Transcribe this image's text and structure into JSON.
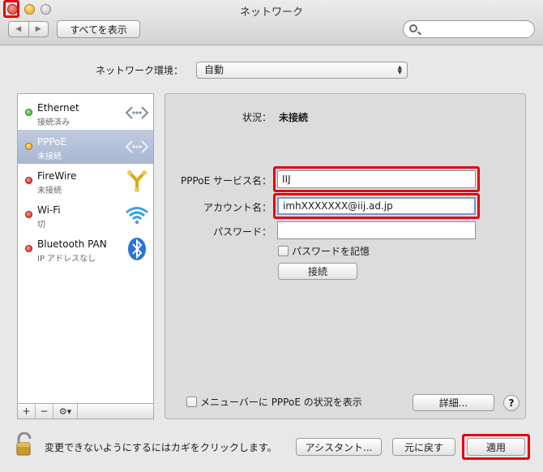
{
  "window": {
    "title": "ネットワーク"
  },
  "toolbar": {
    "show_all_label": "すべてを表示",
    "search_placeholder": ""
  },
  "location": {
    "label": "ネットワーク環境：",
    "value": "自動"
  },
  "services": [
    {
      "name": "Ethernet",
      "status": "接続済み",
      "icon": "ethernet-arrows-icon",
      "dot": "green"
    },
    {
      "name": "PPPoE",
      "status": "未接続",
      "icon": "ethernet-arrows-icon",
      "dot": "yellow",
      "selected": true
    },
    {
      "name": "FireWire",
      "status": "未接続",
      "icon": "firewire-icon",
      "dot": "red"
    },
    {
      "name": "Wi-Fi",
      "status": "切",
      "icon": "wifi-icon",
      "dot": "red"
    },
    {
      "name": "Bluetooth PAN",
      "status": "IP アドレスなし",
      "icon": "bluetooth-icon",
      "dot": "red"
    }
  ],
  "sidebar_actions": {
    "add": "+",
    "remove": "−",
    "gear": "⚙▾"
  },
  "panel": {
    "status_label": "状況：",
    "status_value": "未接続",
    "service_name_label": "PPPoE サービス名：",
    "service_name_value": "IIJ",
    "account_label": "アカウント名：",
    "account_value": "imhXXXXXXX@iij.ad.jp",
    "password_label": "パスワード：",
    "password_value": "",
    "remember_password_label": "パスワードを記憶",
    "connect_label": "接続",
    "menubar_status_label": "メニューバーに PPPoE の状況を表示",
    "advanced_label": "詳細...",
    "help_label": "?"
  },
  "footer": {
    "lock_text": "変更できないようにするにはカギをクリックします。",
    "assistant_label": "アシスタント...",
    "revert_label": "元に戻す",
    "apply_label": "適用"
  },
  "colors": {
    "highlight": "#e60012",
    "selection": "#a8b6d1",
    "focus": "#6d98d9"
  }
}
